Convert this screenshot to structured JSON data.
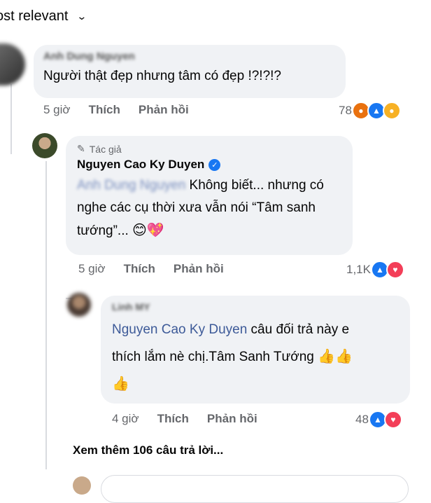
{
  "sort": {
    "label": "ost relevant",
    "chevron_icon": "chevron-down-icon"
  },
  "comment1": {
    "author": "Anh Dung Nguyen",
    "text": "Người thật đẹp nhưng tâm có đẹp !?!?!?",
    "time": "5 giờ",
    "like_label": "Thích",
    "reply_label": "Phản hồi",
    "reaction_count": "78",
    "reactions": [
      "angry",
      "like",
      "haha"
    ]
  },
  "reply1": {
    "badge": "Tác giả",
    "author": "Nguyen Cao Ky Duyen",
    "mention": "Anh Dung Nguyen",
    "text_line1": " Không biết... nhưng có",
    "text_line2": "nghe các cụ thời xưa vẫn nói “Tâm sanh",
    "text_line3": "tướng”...",
    "emojis": "😊💖",
    "time": "5 giờ",
    "like_label": "Thích",
    "reply_label": "Phản hồi",
    "reaction_count": "1,1K",
    "reactions": [
      "like",
      "love"
    ]
  },
  "reply2": {
    "author": "Linh MY",
    "mention": "Nguyen Cao Ky Duyen",
    "text_line1": " câu đối trả này e",
    "text_line2": "thích lắm nè chị.Tâm Sanh Tướng",
    "emojis_line2": "👍👍",
    "emojis_line3": "👍",
    "time": "4 giờ",
    "like_label": "Thích",
    "reply_label": "Phản hồi",
    "reaction_count": "48",
    "reactions": [
      "like",
      "love"
    ]
  },
  "more_replies": "Xem thêm 106 câu trả lời...",
  "colors": {
    "link": "#3d5a98",
    "bubble": "#f0f2f5",
    "meta": "#65676b",
    "like": "#1877f2",
    "love": "#f33e58"
  }
}
